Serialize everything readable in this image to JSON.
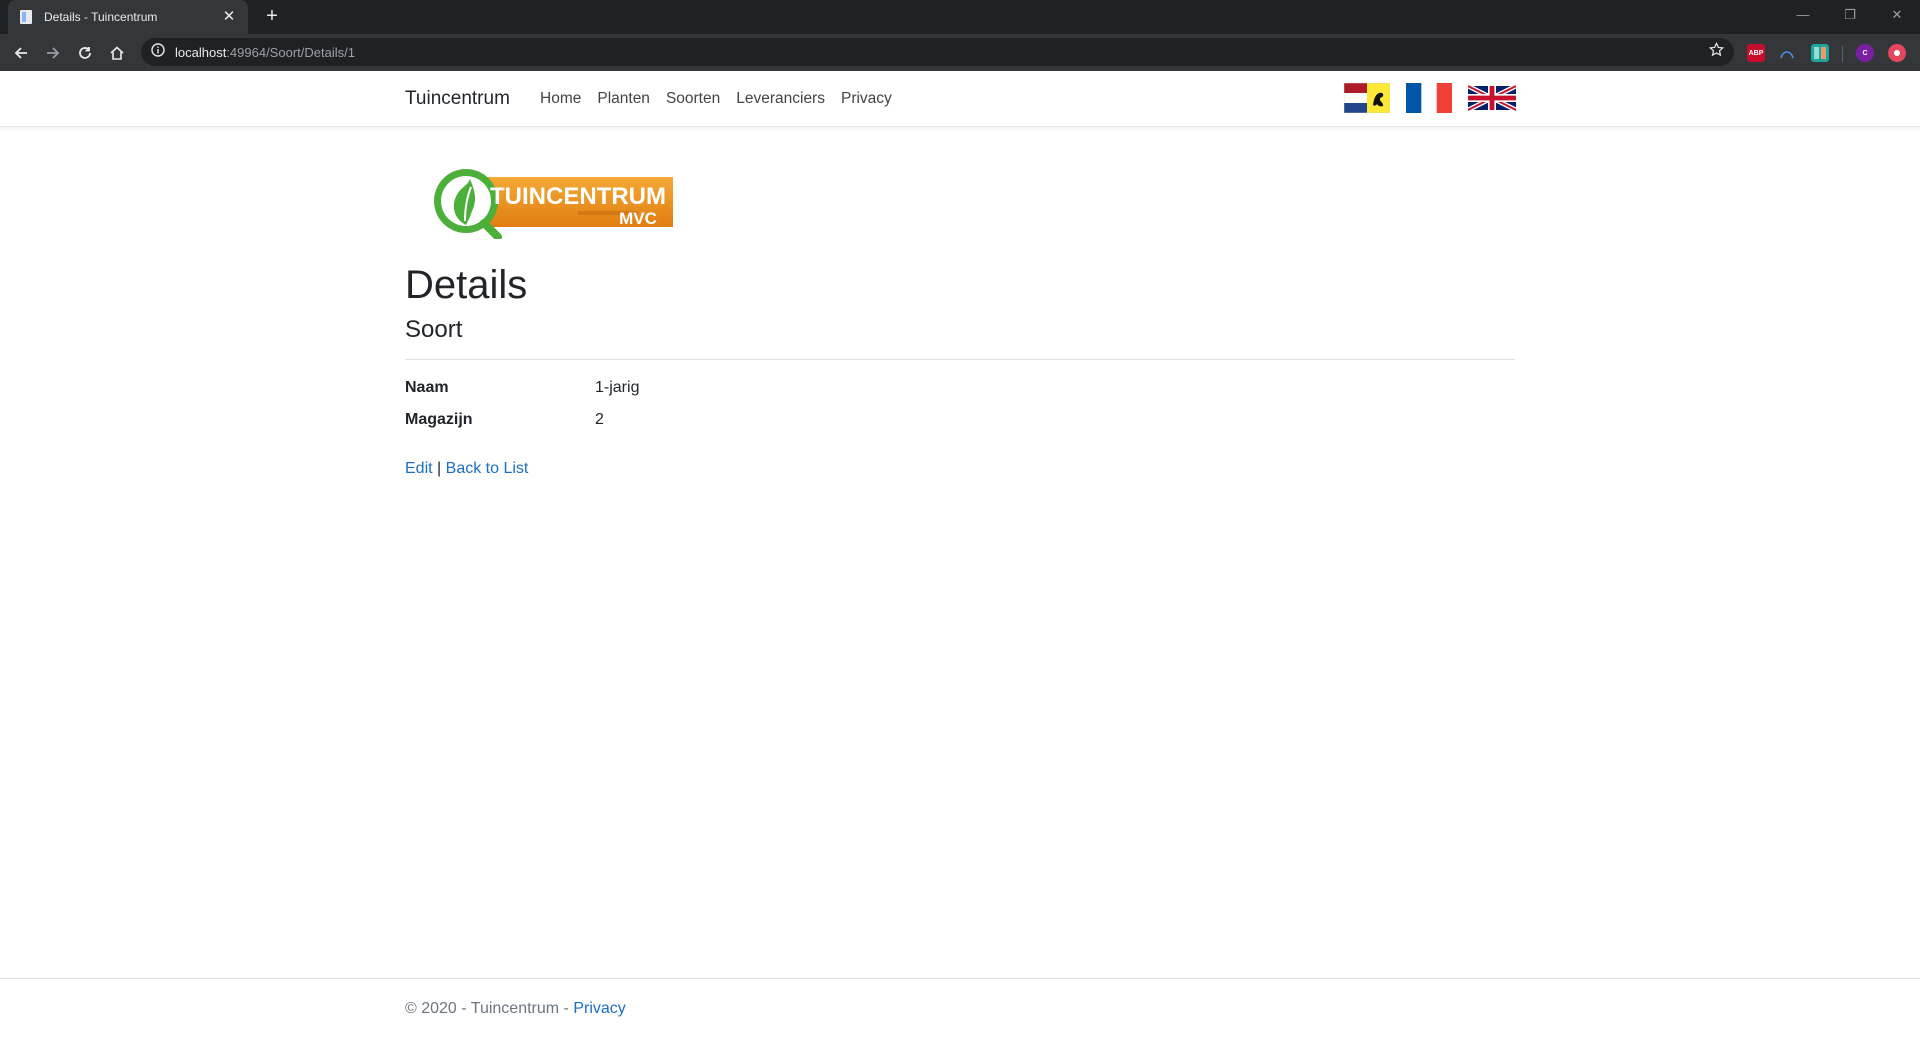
{
  "browser": {
    "tab_title": "Details - Tuincentrum",
    "url_host": "localhost",
    "url_rest": ":49964/Soort/Details/1",
    "extensions": [
      {
        "name": "adblock-plus-icon",
        "label": "ABP",
        "color": "#c70d2c"
      },
      {
        "name": "translate-icon",
        "label": "",
        "color": "#35363a"
      },
      {
        "name": "extension-icon",
        "label": "",
        "color": "#1fa39b"
      },
      {
        "name": "profile-avatar",
        "label": "C",
        "color": "#7b1fa2"
      },
      {
        "name": "extension-red-icon",
        "label": "",
        "color": "#e4475c"
      }
    ]
  },
  "navbar": {
    "brand": "Tuincentrum",
    "links": [
      "Home",
      "Planten",
      "Soorten",
      "Leveranciers",
      "Privacy"
    ],
    "flags": [
      {
        "name": "flag-flemish-icon",
        "lang": "nl"
      },
      {
        "name": "flag-france-icon",
        "lang": "fr"
      },
      {
        "name": "flag-uk-icon",
        "lang": "en"
      }
    ]
  },
  "logo": {
    "line1": "TUINCENTRUM",
    "line2": "MVC"
  },
  "main": {
    "title": "Details",
    "subtitle": "Soort",
    "fields": [
      {
        "label": "Naam",
        "value": "1-jarig"
      },
      {
        "label": "Magazijn",
        "value": "2"
      }
    ],
    "edit_link": "Edit",
    "separator": "|",
    "back_link": "Back to List"
  },
  "footer": {
    "text": "© 2020 - Tuincentrum - ",
    "privacy_link": "Privacy"
  },
  "colors": {
    "link": "#1b6ec2",
    "chrome_dark": "#202124",
    "chrome_toolbar": "#35363a"
  }
}
